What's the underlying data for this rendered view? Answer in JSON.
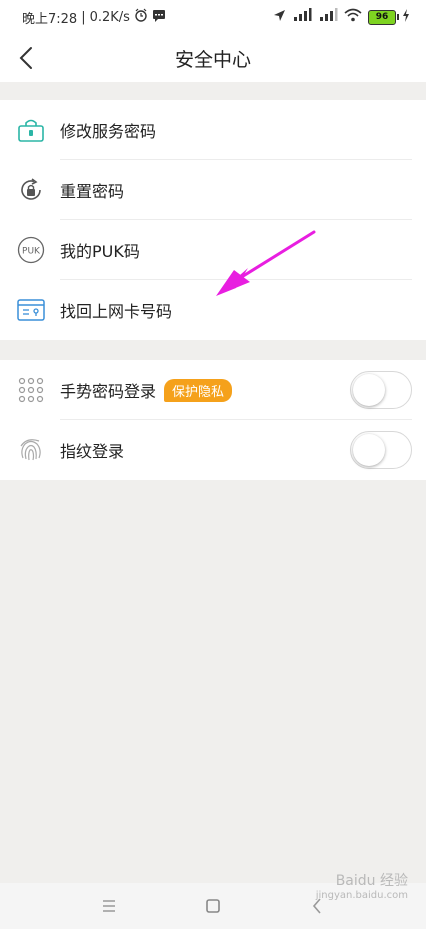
{
  "status_bar": {
    "time": "晚上7:28",
    "speed": "0.2K/s",
    "battery": "96"
  },
  "header": {
    "title": "安全中心"
  },
  "section1": {
    "items": [
      {
        "label": "修改服务密码",
        "icon": "lock-icon"
      },
      {
        "label": "重置密码",
        "icon": "reset-lock-icon"
      },
      {
        "label": "我的PUK码",
        "icon": "puk-icon",
        "icon_text": "PUK"
      },
      {
        "label": "找回上网卡号码",
        "icon": "sim-card-icon"
      }
    ]
  },
  "section2": {
    "items": [
      {
        "label": "手势密码登录",
        "badge": "保护隐私",
        "icon": "gesture-grid-icon",
        "toggle_on": false
      },
      {
        "label": "指纹登录",
        "icon": "fingerprint-icon",
        "toggle_on": false
      }
    ]
  },
  "watermark": {
    "text": "Baidu 经验",
    "url": "jingyan.baidu.com"
  },
  "colors": {
    "accent_teal": "#2bb5a6",
    "badge_orange": "#f5a11b",
    "arrow_magenta": "#e81ee0",
    "battery_green": "#7ed321"
  }
}
